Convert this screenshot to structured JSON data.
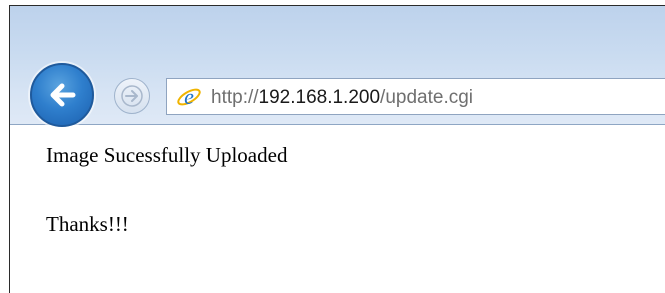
{
  "browser": {
    "back_icon": "back-arrow-icon",
    "forward_icon": "forward-arrow-icon",
    "site_icon": "internet-explorer-icon",
    "address": {
      "scheme": "http://",
      "host": "192.168.1.200",
      "path": "/update.cgi"
    }
  },
  "page": {
    "message": "Image Sucessfully Uploaded",
    "thanks": "Thanks!!!"
  },
  "colors": {
    "back_button": "#2f7fcd",
    "toolbar": "#c9dbf0"
  }
}
